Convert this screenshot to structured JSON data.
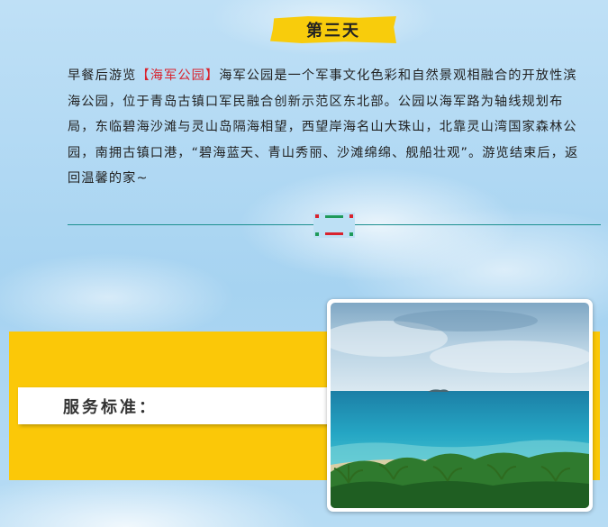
{
  "day_badge": "第三天",
  "paragraph": {
    "intro": "早餐后游览",
    "highlight": "【海军公园】",
    "body": "海军公园是一个军事文化色彩和自然景观相融合的开放性滨海公园，位于青岛古镇口军民融合创新示范区东北部。公园以海军路为轴线规划布局，东临碧海沙滩与灵山岛隔海相望，西望岸海名山大珠山，北靠灵山湾国家森林公园，南拥古镇口港，“碧海蓝天、青山秀丽、沙滩绵绵、舰船壮观”。游览结束后，返回温馨的家~"
  },
  "service_heading": "服务标准：",
  "photo": {
    "description_icon": "seascape-image"
  },
  "colors": {
    "accent_yellow": "#fbc808",
    "highlight_red": "#d9232e",
    "divider_teal": "#1c8f8f",
    "divider_green": "#1f9a5a"
  }
}
